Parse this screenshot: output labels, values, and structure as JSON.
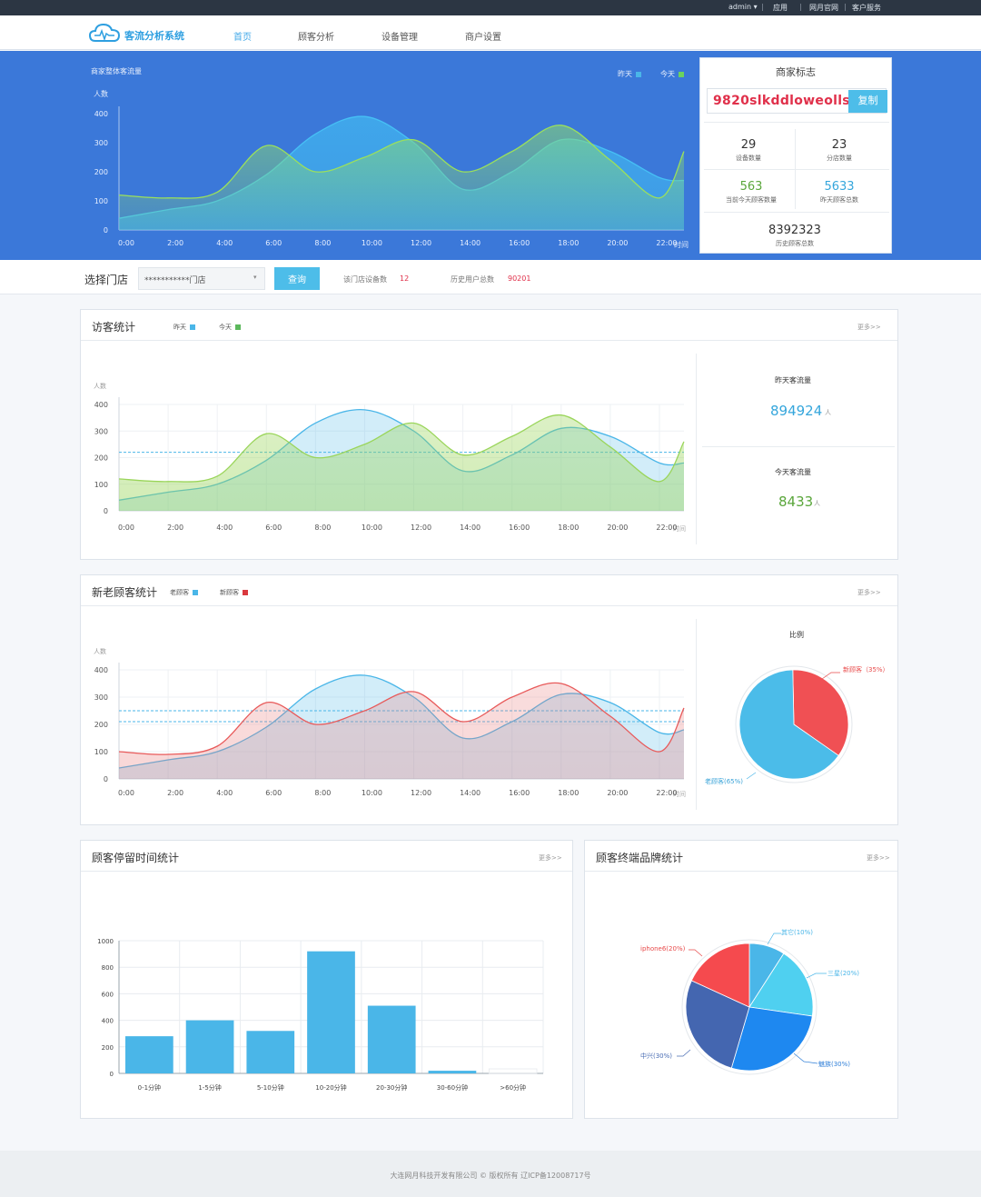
{
  "topbar": {
    "user": "admin ▾",
    "links": [
      "应用",
      "网月官网",
      "客户服务"
    ]
  },
  "header": {
    "logo_text": "客流分析系统",
    "nav": [
      "首页",
      "顾客分析",
      "设备管理",
      "商户设置"
    ],
    "active_nav": "首页"
  },
  "hero": {
    "chart_title": "商家整体客流量",
    "legend": [
      "昨天",
      "今天"
    ],
    "y_axis_label": "人数",
    "x_axis_label": "时间"
  },
  "merchant": {
    "title": "商家标志",
    "code": "9820slkddloweolls",
    "copy_label": "复制",
    "stats": [
      {
        "value": "29",
        "label": "设备数量"
      },
      {
        "value": "23",
        "label": "分店数量"
      },
      {
        "value": "563",
        "label": "当前今天顾客数量"
      },
      {
        "value": "5633",
        "label": "昨天顾客总数"
      },
      {
        "value": "8392323",
        "label": "历史顾客总数"
      }
    ]
  },
  "store_select": {
    "label": "选择门店",
    "value": "***********门店",
    "query_label": "查询",
    "device_count_label": "该门店设备数",
    "device_count": "12",
    "history_users_label": "历史用户总数",
    "history_users": "90201"
  },
  "visitor_panel": {
    "title": "访客统计",
    "legend": [
      "昨天",
      "今天"
    ],
    "more": "更多>>",
    "y_axis_label": "人数",
    "x_axis_label": "时间",
    "yesterday_label": "昨天客流量",
    "yesterday_value": "894924",
    "yesterday_unit": "人",
    "today_label": "今天客流量",
    "today_value": "8433",
    "today_unit": "人"
  },
  "newold_panel": {
    "title": "新老顾客统计",
    "legend": [
      "老顾客",
      "新顾客"
    ],
    "more": "更多>>",
    "y_axis_label": "人数",
    "x_axis_label": "时间",
    "pie_title": "比例",
    "pie_labels": [
      "新顾客（35%）",
      "老顾客(65%)"
    ]
  },
  "dwell_panel": {
    "title": "顾客停留时间统计",
    "more": "更多>>"
  },
  "brand_panel": {
    "title": "顾客终端品牌统计",
    "more": "更多>>",
    "labels": [
      "其它(10%)",
      "三星(20%)",
      "魅族(30%)",
      "中兴(30%)",
      "iphone6(20%)"
    ]
  },
  "footer": {
    "text": "大连网月科技开发有限公司 © 版权所有 辽ICP备12008717号"
  },
  "colors": {
    "hero_bg": "#3b78d9",
    "accent_blue": "#4ab6e8",
    "accent_green": "#8fd14f",
    "accent_red": "#e84a4a",
    "code_red": "#e0304a"
  },
  "chart_data": [
    {
      "type": "area",
      "title": "商家整体客流量",
      "x": [
        "0:00",
        "2:00",
        "4:00",
        "6:00",
        "8:00",
        "10:00",
        "12:00",
        "14:00",
        "16:00",
        "18:00",
        "20:00",
        "22:00"
      ],
      "ylabel": "人数",
      "xlabel": "时间",
      "ylim": [
        0,
        400
      ],
      "yticks": [
        0,
        100,
        200,
        300,
        400
      ],
      "series": [
        {
          "name": "昨天",
          "values": [
            40,
            70,
            100,
            190,
            330,
            390,
            300,
            140,
            200,
            310,
            270,
            180,
            170
          ],
          "x_points": [
            0,
            2,
            4,
            6,
            8,
            10,
            12,
            14,
            16,
            18,
            20,
            22,
            23
          ]
        },
        {
          "name": "今天",
          "values": [
            120,
            110,
            130,
            290,
            200,
            250,
            310,
            200,
            270,
            360,
            240,
            110,
            270
          ],
          "x_points": [
            0,
            2,
            4,
            6,
            8,
            10,
            12,
            14,
            16,
            18,
            20,
            22,
            23
          ]
        }
      ]
    },
    {
      "type": "area",
      "title": "访客统计",
      "x": [
        "0:00",
        "2:00",
        "4:00",
        "6:00",
        "8:00",
        "10:00",
        "12:00",
        "14:00",
        "16:00",
        "18:00",
        "20:00",
        "22:00"
      ],
      "ylabel": "人数",
      "xlabel": "时间",
      "ylim": [
        0,
        400
      ],
      "yticks": [
        0,
        100,
        200,
        300,
        400
      ],
      "reference_line": 220,
      "series": [
        {
          "name": "昨天",
          "values": [
            40,
            70,
            100,
            190,
            330,
            380,
            300,
            150,
            210,
            310,
            280,
            180,
            180
          ],
          "x_points": [
            0,
            2,
            4,
            6,
            8,
            10,
            12,
            14,
            16,
            18,
            20,
            22,
            23
          ]
        },
        {
          "name": "今天",
          "values": [
            120,
            110,
            130,
            290,
            200,
            250,
            330,
            210,
            280,
            360,
            240,
            110,
            260
          ],
          "x_points": [
            0,
            2,
            4,
            6,
            8,
            10,
            12,
            14,
            16,
            18,
            20,
            22,
            23
          ]
        }
      ]
    },
    {
      "type": "area",
      "title": "新老顾客统计",
      "x": [
        "0:00",
        "2:00",
        "4:00",
        "6:00",
        "8:00",
        "10:00",
        "12:00",
        "14:00",
        "16:00",
        "18:00",
        "20:00",
        "22:00"
      ],
      "ylabel": "人数",
      "xlabel": "时间",
      "ylim": [
        0,
        400
      ],
      "yticks": [
        0,
        100,
        200,
        300,
        400
      ],
      "reference_lines": [
        250,
        210
      ],
      "series": [
        {
          "name": "老顾客",
          "values": [
            40,
            70,
            100,
            190,
            330,
            380,
            300,
            150,
            210,
            310,
            280,
            170,
            180
          ],
          "x_points": [
            0,
            2,
            4,
            6,
            8,
            10,
            12,
            14,
            16,
            18,
            20,
            22,
            23
          ]
        },
        {
          "name": "新顾客",
          "values": [
            100,
            90,
            120,
            280,
            200,
            250,
            320,
            210,
            300,
            350,
            230,
            100,
            260
          ],
          "x_points": [
            0,
            2,
            4,
            6,
            8,
            10,
            12,
            14,
            16,
            18,
            20,
            22,
            23
          ]
        }
      ]
    },
    {
      "type": "pie",
      "title": "比例",
      "labels": [
        "新顾客",
        "老顾客"
      ],
      "values": [
        35,
        65
      ]
    },
    {
      "type": "bar",
      "title": "顾客停留时间统计",
      "categories": [
        "0-1分钟",
        "1-5分钟",
        "5-10分钟",
        "10-20分钟",
        "20-30分钟",
        "30-60分钟",
        ">60分钟"
      ],
      "values": [
        280,
        400,
        320,
        920,
        510,
        20,
        0
      ],
      "ylim": [
        0,
        1000
      ],
      "yticks": [
        0,
        200,
        400,
        600,
        800,
        1000
      ]
    },
    {
      "type": "pie",
      "title": "顾客终端品牌统计",
      "labels": [
        "其它",
        "三星",
        "魅族",
        "中兴",
        "iphone6"
      ],
      "values": [
        10,
        20,
        30,
        30,
        20
      ]
    }
  ]
}
